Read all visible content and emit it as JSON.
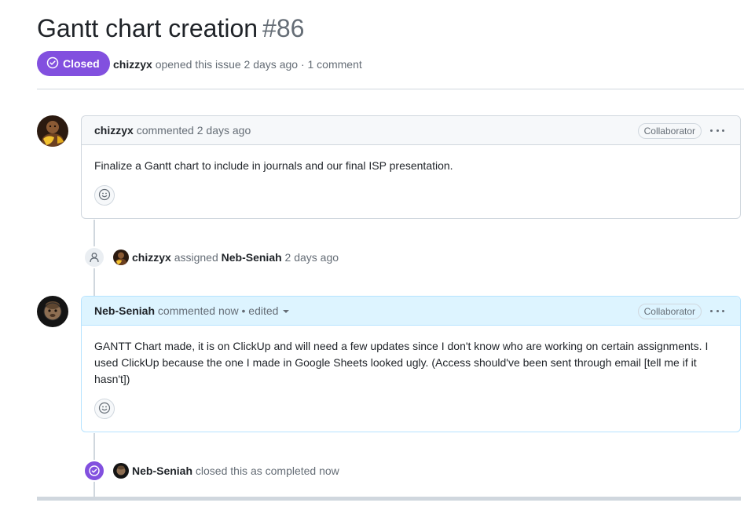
{
  "issue": {
    "title": "Gantt chart creation",
    "number": "#86",
    "state": "Closed",
    "author": "chizzyx",
    "opened_text": "opened this issue 2 days ago · 1 comment"
  },
  "comments": [
    {
      "author": "chizzyx",
      "meta": "commented 2 days ago",
      "role": "Collaborator",
      "body": "Finalize a Gantt chart to include in journals and our final ISP presentation."
    },
    {
      "author": "Neb-Seniah",
      "meta": "commented now • edited",
      "role": "Collaborator",
      "body": "GANTT Chart made, it is on ClickUp and will need a few updates since I don't know who are working on certain assignments. I used ClickUp because the one I made in Google Sheets looked ugly. (Access should've been sent through email [tell me if it hasn't])"
    }
  ],
  "events": [
    {
      "actor": "chizzyx",
      "action": "assigned",
      "target": "Neb-Seniah",
      "time": "2 days ago",
      "icon": "person-icon"
    },
    {
      "actor": "Neb-Seniah",
      "action": "closed this as completed now",
      "icon": "check-circle-icon"
    }
  ],
  "colors": {
    "closed_purple": "#8250df",
    "own_comment_header": "#ddf4ff",
    "border": "#d0d7de",
    "muted_text": "#656d76"
  }
}
